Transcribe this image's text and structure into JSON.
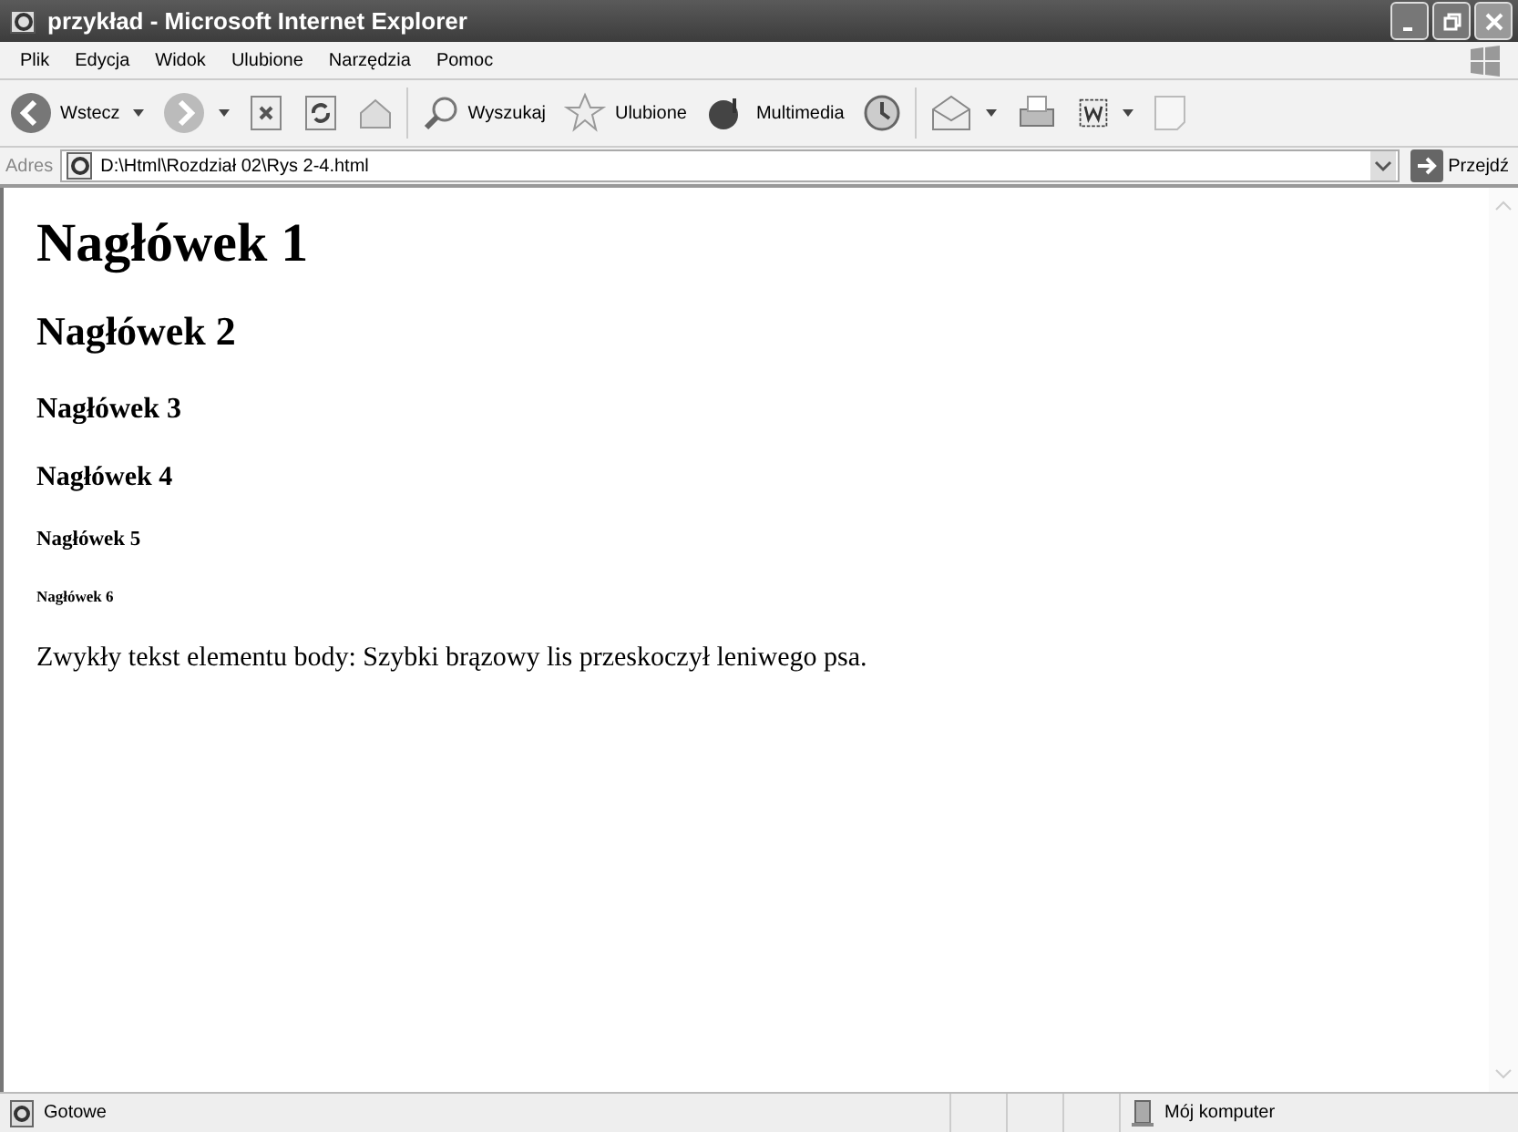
{
  "window": {
    "title": "przykład - Microsoft Internet Explorer"
  },
  "menu": [
    "Plik",
    "Edycja",
    "Widok",
    "Ulubione",
    "Narzędzia",
    "Pomoc"
  ],
  "toolbar": [
    {
      "kind": "back",
      "label": "Wstecz",
      "dropdown": true
    },
    {
      "kind": "forward",
      "dropdown": true
    },
    {
      "kind": "stop",
      "dropdown": false
    },
    {
      "kind": "refresh",
      "dropdown": false
    },
    {
      "kind": "home",
      "dropdown": false
    },
    {
      "kind": "search",
      "label": "Wyszukaj",
      "dropdown": false
    },
    {
      "kind": "favorites",
      "label": "Ulubione",
      "dropdown": false
    },
    {
      "kind": "media",
      "label": "Multimedia",
      "dropdown": false
    },
    {
      "kind": "history",
      "dropdown": false
    },
    {
      "kind": "mail",
      "dropdown": true
    },
    {
      "kind": "print",
      "dropdown": false
    },
    {
      "kind": "word",
      "dropdown": true
    },
    {
      "kind": "blank",
      "dropdown": false
    }
  ],
  "address": {
    "label": "Adres",
    "value": "D:\\Html\\Rozdział 02\\Rys 2-4.html",
    "go": "Przejdź"
  },
  "page": {
    "headings": [
      "Nagłówek 1",
      "Nagłówek 2",
      "Nagłówek 3",
      "Nagłówek 4",
      "Nagłówek 5",
      "Nagłówek 6"
    ],
    "paragraph": "Zwykły tekst elementu body: Szybki brązowy lis przeskoczył leniwego psa."
  },
  "status_bar": {
    "text": "Gotowe",
    "zone": "Mój komputer"
  }
}
